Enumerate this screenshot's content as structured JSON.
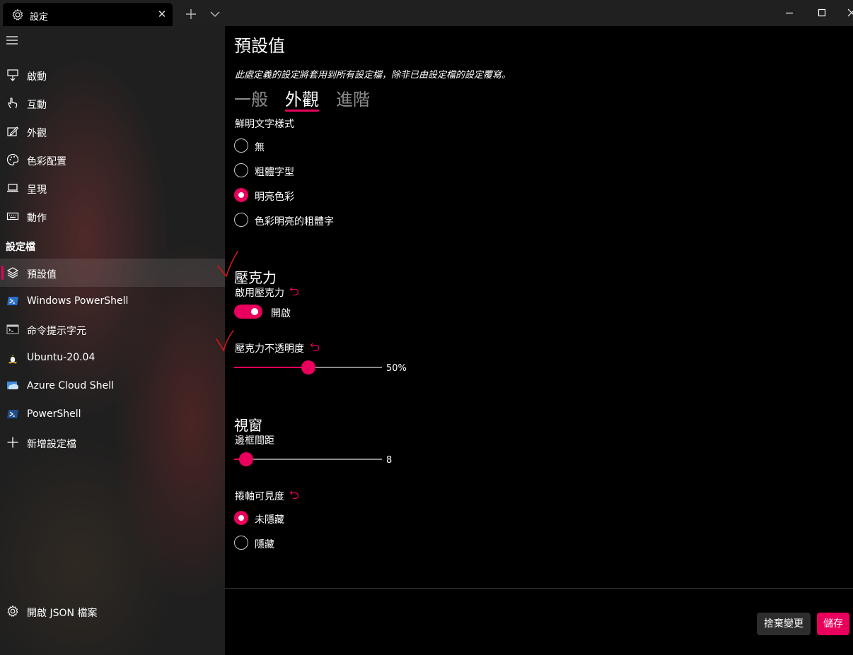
{
  "window": {
    "tab_title": "設定",
    "tab_icon": "gear-icon",
    "close_tab_glyph": "✕"
  },
  "sidebar": {
    "items": [
      {
        "label": "啟動",
        "icon": "startup-icon"
      },
      {
        "label": "互動",
        "icon": "interaction-icon"
      },
      {
        "label": "外觀",
        "icon": "appearance-icon"
      },
      {
        "label": "色彩配置",
        "icon": "palette-icon"
      },
      {
        "label": "呈現",
        "icon": "rendering-icon"
      },
      {
        "label": "動作",
        "icon": "keyboard-icon"
      }
    ],
    "profiles_header": "設定檔",
    "profiles": [
      {
        "label": "預設值",
        "icon": "layers-icon",
        "selected": true
      },
      {
        "label": "Windows PowerShell",
        "icon": "powershell-icon"
      },
      {
        "label": "命令提示字元",
        "icon": "cmd-icon"
      },
      {
        "label": "Ubuntu-20.04",
        "icon": "linux-icon"
      },
      {
        "label": "Azure Cloud Shell",
        "icon": "azure-icon"
      },
      {
        "label": "PowerShell",
        "icon": "powershell-core-icon"
      },
      {
        "label": "新增設定檔",
        "icon": "plus-icon"
      }
    ],
    "open_json": "開啟 JSON 檔案"
  },
  "main": {
    "title": "預設值",
    "description": "此處定義的設定將套用到所有設定檔，除非已由設定檔的設定覆寫。",
    "tabs": [
      {
        "label": "一般",
        "active": false
      },
      {
        "label": "外觀",
        "active": true
      },
      {
        "label": "進階",
        "active": false
      }
    ],
    "intense_text": {
      "label": "鮮明文字樣式",
      "options": [
        "無",
        "粗體字型",
        "明亮色彩",
        "色彩明亮的粗體字"
      ],
      "selected": "明亮色彩"
    },
    "acrylic": {
      "section_title": "壓克力",
      "enable_label": "啟用壓克力",
      "toggle_state": "開啟",
      "toggle_on": true,
      "opacity_label": "壓克力不透明度",
      "opacity_value": 50,
      "opacity_display": "50%"
    },
    "window": {
      "section_title": "視窗",
      "padding_label": "邊框間距",
      "padding_value": 8,
      "padding_display": "8",
      "padding_max": 100,
      "scrollbar_label": "捲軸可見度",
      "scrollbar_options": [
        "未隱藏",
        "隱藏"
      ],
      "scrollbar_selected": "未隱藏"
    },
    "buttons": {
      "discard": "捨棄變更",
      "save": "儲存"
    }
  },
  "colors": {
    "accent": "#e8005c",
    "sidebar_bg": "#1f1f1f",
    "main_bg": "#000000",
    "annotation_red": "#d01818"
  }
}
